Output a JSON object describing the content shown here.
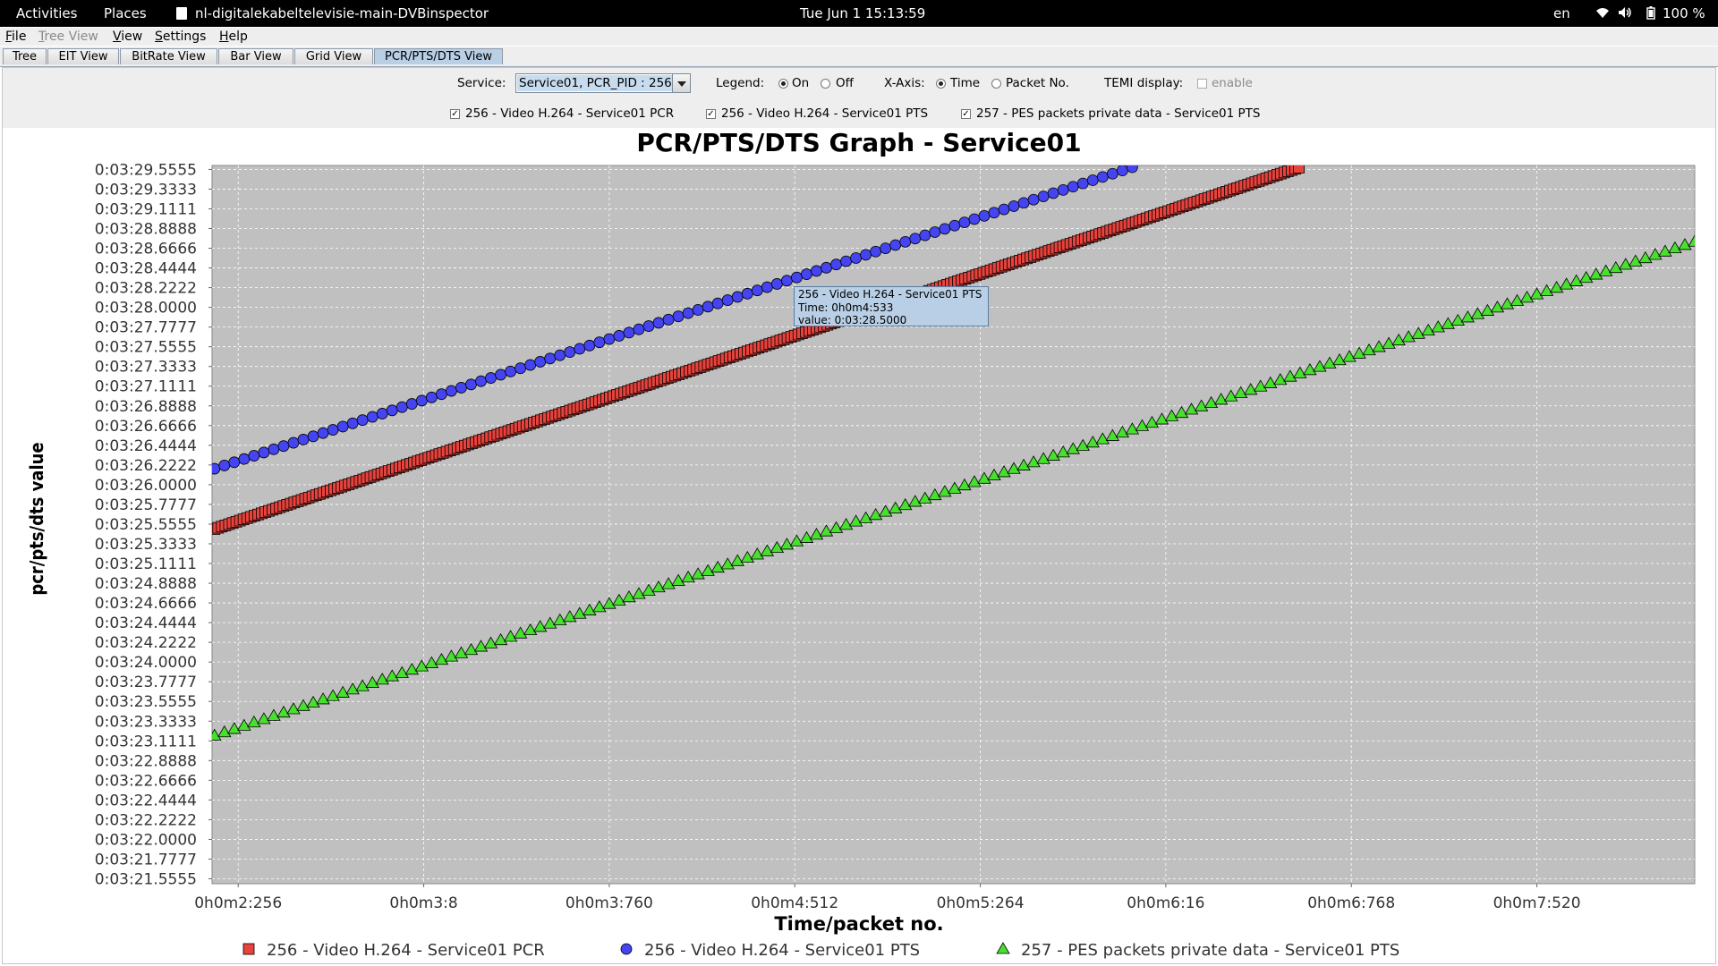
{
  "topbar": {
    "activities": "Activities",
    "places": "Places",
    "app_title": "nl-digitalekabeltelevisie-main-DVBinspector",
    "clock": "Tue Jun 1  15:13:59",
    "lang": "en",
    "battery": "100 %"
  },
  "menubar": {
    "file": "File",
    "tree_view": "Tree View",
    "view": "View",
    "settings": "Settings",
    "help": "Help"
  },
  "tabs": [
    "Tree",
    "EIT View",
    "BitRate View",
    "Bar View",
    "Grid View",
    "PCR/PTS/DTS View"
  ],
  "controls": {
    "service_label": "Service:",
    "service_value": "Service01, PCR_PID : 256",
    "legend_label": "Legend:",
    "legend_on": "On",
    "legend_off": "Off",
    "legend_selected": "On",
    "xaxis_label": "X-Axis:",
    "xaxis_time": "Time",
    "xaxis_packet": "Packet No.",
    "xaxis_selected": "Time",
    "temi_label": "TEMI display:",
    "temi_enable": "enable",
    "series_toggles": [
      {
        "label": "256 - Video H.264 - Service01 PCR",
        "checked": true
      },
      {
        "label": "256 - Video H.264 - Service01 PTS",
        "checked": true
      },
      {
        "label": "257 - PES packets private data - Service01 PTS",
        "checked": true
      }
    ]
  },
  "tooltip": {
    "series": "256 - Video H.264 - Service01 PTS",
    "time": "Time: 0h0m4:533",
    "value": "value: 0:03:28.5000"
  },
  "chart_data": {
    "type": "scatter",
    "title": "PCR/PTS/DTS Graph - Service01",
    "xlabel": "Time/packet no.",
    "ylabel": "pcr/pts/dts value",
    "x_unit": "seconds",
    "xlim": [
      2.15,
      8.16
    ],
    "ylim": [
      201.5,
      209.6
    ],
    "x_ticks": [
      "0h0m2:256",
      "0h0m3:8",
      "0h0m3:760",
      "0h0m4:512",
      "0h0m5:264",
      "0h0m6:16",
      "0h0m6:768",
      "0h0m7:520"
    ],
    "x_tick_values": [
      2.256,
      3.008,
      3.76,
      4.512,
      5.264,
      6.016,
      6.768,
      7.52
    ],
    "y_ticks": [
      "0:03:21.5555",
      "0:03:21.7777",
      "0:03:22.0000",
      "0:03:22.2222",
      "0:03:22.4444",
      "0:03:22.6666",
      "0:03:22.8888",
      "0:03:23.1111",
      "0:03:23.3333",
      "0:03:23.5555",
      "0:03:23.7777",
      "0:03:24.0000",
      "0:03:24.2222",
      "0:03:24.4444",
      "0:03:24.6666",
      "0:03:24.8888",
      "0:03:25.1111",
      "0:03:25.3333",
      "0:03:25.5555",
      "0:03:25.7777",
      "0:03:26.0000",
      "0:03:26.2222",
      "0:03:26.4444",
      "0:03:26.6666",
      "0:03:26.8888",
      "0:03:27.1111",
      "0:03:27.3333",
      "0:03:27.5555",
      "0:03:27.7777",
      "0:03:28.0000",
      "0:03:28.2222",
      "0:03:28.4444",
      "0:03:28.6666",
      "0:03:28.8888",
      "0:03:29.1111",
      "0:03:29.3333",
      "0:03:29.5555"
    ],
    "y_tick_values": [
      201.5555,
      201.7777,
      202.0,
      202.2222,
      202.4444,
      202.6666,
      202.8888,
      203.1111,
      203.3333,
      203.5555,
      203.7777,
      204.0,
      204.2222,
      204.4444,
      204.6666,
      204.8888,
      205.1111,
      205.3333,
      205.5555,
      205.7777,
      206.0,
      206.2222,
      206.4444,
      206.6666,
      206.8888,
      207.1111,
      207.3333,
      207.5555,
      207.7777,
      208.0,
      208.2222,
      208.4444,
      208.6666,
      208.8888,
      209.1111,
      209.3333,
      209.5555
    ],
    "grid": true,
    "legend_position": "bottom",
    "series": [
      {
        "name": "256 - Video H.264 - Service01 PCR",
        "marker": "square",
        "color": "#e8423c",
        "x": [
          2.16,
          6.56
        ],
        "y": [
          205.5,
          209.58
        ],
        "point_spacing": 0.0147
      },
      {
        "name": "256 - Video H.264 - Service01 PTS",
        "marker": "circle",
        "color": "#4444f0",
        "x": [
          2.16,
          5.88
        ],
        "y": [
          206.18,
          209.58
        ],
        "point_spacing": 0.04
      },
      {
        "name": "257 - PES packets private data - Service01 PTS",
        "marker": "triangle",
        "color": "#48e02e",
        "x": [
          2.16,
          8.16
        ],
        "y": [
          203.17,
          208.74
        ],
        "point_spacing": 0.04
      }
    ]
  },
  "colors": {
    "plot_bg": "#c0c0c0",
    "panel_bg": "#eeeeee",
    "tooltip_bg": "#b8cfe5"
  }
}
